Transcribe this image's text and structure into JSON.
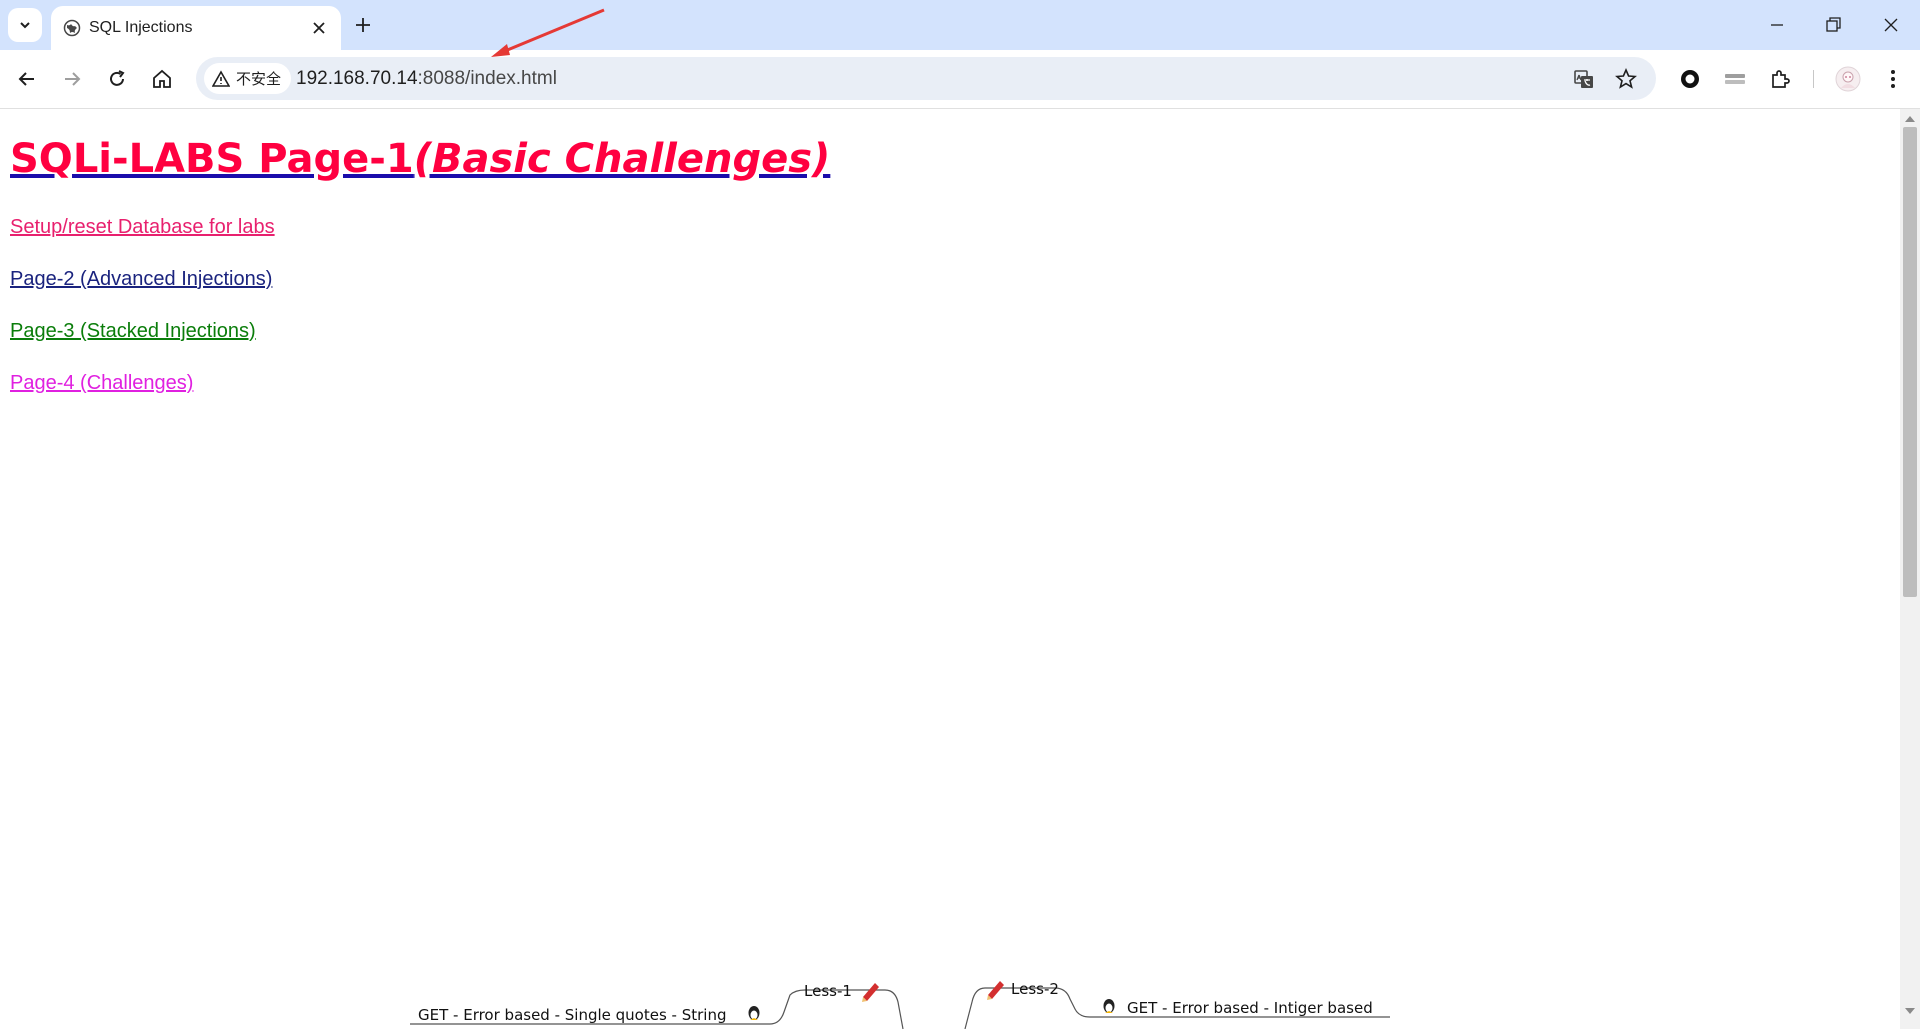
{
  "browser": {
    "tab": {
      "title": "SQL Injections"
    },
    "address_bar": {
      "security_label": "不安全",
      "url_host": "192.168.70.14",
      "url_path": ":8088/index.html"
    }
  },
  "page": {
    "heading": {
      "main": "SQLi-LABS Page-1",
      "sub": "(Basic Challenges)"
    },
    "links": [
      {
        "label": "Setup/reset Database for labs",
        "color": "#e8206e"
      },
      {
        "label": "Page-2 (Advanced Injections)",
        "color": "#1a237e"
      },
      {
        "label": "Page-3 (Stacked Injections)",
        "color": "#0a7d0a"
      },
      {
        "label": "Page-4 (Challenges)",
        "color": "#e020e0"
      }
    ],
    "mindmap": {
      "less1_label": "Less-1",
      "less1_desc": "GET - Error based - Single quotes - String",
      "less2_label": "Less-2",
      "less2_desc": "GET - Error based - Intiger based"
    }
  },
  "colors": {
    "tabstrip": "#d3e3fd",
    "heading": "#ff0040",
    "annotation_arrow": "#e53935"
  },
  "icons": [
    "tab-search-icon",
    "globe-icon",
    "close-icon",
    "plus-icon",
    "minimize-icon",
    "restore-icon",
    "window-close-icon",
    "back-icon",
    "forward-icon",
    "reload-icon",
    "home-icon",
    "warning-icon",
    "translate-icon",
    "star-icon",
    "record-icon",
    "media-icon",
    "extensions-icon",
    "avatar-icon",
    "menu-icon",
    "pencil-icon",
    "linux-penguin-icon"
  ]
}
